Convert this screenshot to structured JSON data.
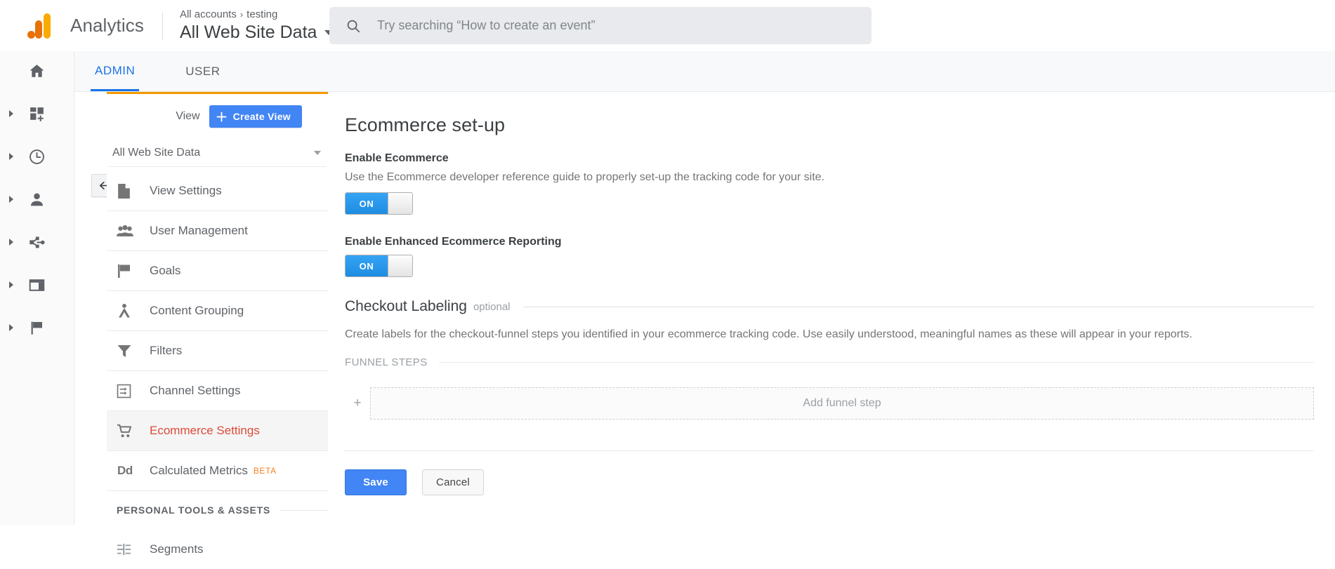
{
  "topbar": {
    "brand": "Analytics",
    "breadcrumb_root": "All accounts",
    "breadcrumb_sep": "›",
    "breadcrumb_account": "testing",
    "view_title": "All Web Site Data",
    "search_placeholder": "Try searching “How to create an event”",
    "logo_colors": {
      "orange": "#e8710a",
      "amber": "#f9ab00"
    }
  },
  "rail": {
    "items": [
      {
        "name": "home",
        "icon": "home-icon",
        "expandable": false
      },
      {
        "name": "customization",
        "icon": "customization-icon",
        "expandable": true
      },
      {
        "name": "realtime",
        "icon": "clock-icon",
        "expandable": true
      },
      {
        "name": "audience",
        "icon": "person-icon",
        "expandable": true
      },
      {
        "name": "acquisition",
        "icon": "share-nodes-icon",
        "expandable": true
      },
      {
        "name": "behavior",
        "icon": "window-layout-icon",
        "expandable": true
      },
      {
        "name": "conversions",
        "icon": "flag-icon",
        "expandable": true
      }
    ],
    "collapse_icon": "collapse-left-arrow-icon"
  },
  "tabs": [
    {
      "label": "ADMIN",
      "active": true
    },
    {
      "label": "USER",
      "active": false
    }
  ],
  "view_column": {
    "accent_color": "#f29900",
    "header_label": "View",
    "create_button_label": "Create View",
    "selected_view": "All Web Site Data",
    "menu": [
      {
        "label": "View Settings",
        "icon": "document-icon",
        "active": false
      },
      {
        "label": "User Management",
        "icon": "people-icon",
        "active": false
      },
      {
        "label": "Goals",
        "icon": "flag-icon",
        "active": false
      },
      {
        "label": "Content Grouping",
        "icon": "content-grouping-icon",
        "active": false
      },
      {
        "label": "Filters",
        "icon": "funnel-icon",
        "active": false
      },
      {
        "label": "Channel Settings",
        "icon": "channel-settings-icon",
        "active": false
      },
      {
        "label": "Ecommerce Settings",
        "icon": "shopping-cart-icon",
        "active": true
      },
      {
        "label": "Calculated Metrics",
        "icon": "dd-icon",
        "badge": "BETA",
        "active": false
      }
    ],
    "section_header": "PERSONAL TOOLS & ASSETS",
    "section_items": [
      {
        "label": "Segments",
        "icon": "segments-icon"
      }
    ],
    "active_color": "#dd4b39"
  },
  "main": {
    "title": "Ecommerce set-up",
    "enable_ecommerce": {
      "label": "Enable Ecommerce",
      "description": "Use the Ecommerce developer reference guide to properly set-up the tracking code for your site.",
      "toggle_state": "ON"
    },
    "enhanced_reporting": {
      "label": "Enable Enhanced Ecommerce Reporting",
      "toggle_state": "ON"
    },
    "checkout_labeling": {
      "title": "Checkout Labeling",
      "optional_tag": "optional",
      "description": "Create labels for the checkout-funnel steps you identified in your ecommerce tracking code. Use easily understood, meaningful names as these will appear in your reports.",
      "funnel_steps_header": "FUNNEL STEPS",
      "add_step_plus": "+",
      "add_step_label": "Add funnel step"
    },
    "save_label": "Save",
    "cancel_label": "Cancel",
    "accent_blue": "#4285f4"
  }
}
